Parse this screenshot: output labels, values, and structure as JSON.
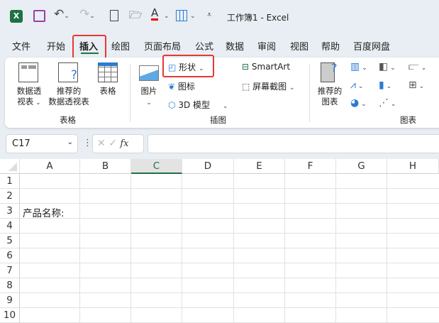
{
  "titlebar": {
    "title": "工作簿1  -  Excel"
  },
  "tabs": [
    "文件",
    "开始",
    "插入",
    "绘图",
    "页面布局",
    "公式",
    "数据",
    "审阅",
    "视图",
    "帮助",
    "百度网盘"
  ],
  "active_tab": "插入",
  "ribbon": {
    "groups": {
      "tables": "表格",
      "illustrations": "插图",
      "charts": "图表"
    },
    "pivot_table": [
      "数据透",
      "视表"
    ],
    "recommended_pivot": [
      "推荐的",
      "数据透视表"
    ],
    "table": "表格",
    "pictures": "图片",
    "shapes": "形状",
    "icons": "图标",
    "models_3d": "3D 模型",
    "smartart": "SmartArt",
    "screenshot": "屏幕截图",
    "recommended_charts": [
      "推荐的",
      "图表"
    ]
  },
  "formula_bar": {
    "name_box": "C17",
    "formula": ""
  },
  "grid": {
    "columns": [
      "A",
      "B",
      "C",
      "D",
      "E",
      "F",
      "G",
      "H"
    ],
    "rows": [
      "1",
      "2",
      "3",
      "4",
      "5",
      "6",
      "7",
      "8",
      "9",
      "10"
    ],
    "selected_column": "C",
    "cells": {
      "A3": "产品名称:"
    }
  },
  "colors": {
    "accent": "#1e7145",
    "highlight": "#e53935"
  }
}
